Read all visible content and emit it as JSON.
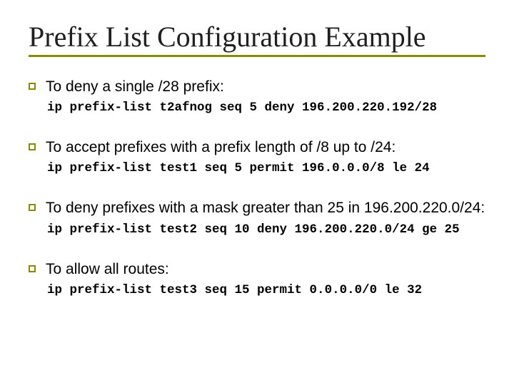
{
  "title": "Prefix List Configuration Example",
  "items": [
    {
      "lead": "To deny a single /28 prefix:",
      "code": "ip prefix-list t2afnog seq 5 deny 196.200.220.192/28"
    },
    {
      "lead": "To accept prefixes with a prefix length of /8 up to /24:",
      "code": "ip prefix-list test1 seq 5 permit 196.0.0.0/8 le 24"
    },
    {
      "lead": "To deny prefixes with a mask greater than 25 in 196.200.220.0/24:",
      "code": "ip prefix-list test2 seq 10 deny 196.200.220.0/24 ge 25"
    },
    {
      "lead": "To allow all routes:",
      "code": "ip prefix-list test3 seq 15 permit 0.0.0.0/0 le 32"
    }
  ]
}
